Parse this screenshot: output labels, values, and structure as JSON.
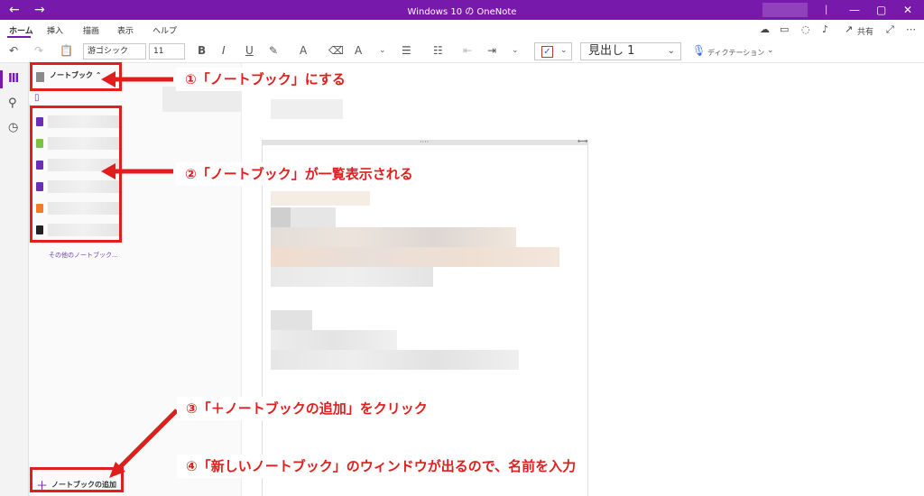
{
  "window": {
    "title": "Windows 10 の OneNote",
    "back_icon": "←",
    "forward_icon": "→",
    "minimize": "—",
    "maximize": "▢",
    "close": "✕"
  },
  "tabs": [
    "ホーム",
    "挿入",
    "描画",
    "表示",
    "ヘルプ"
  ],
  "share_label": "共有",
  "ribbon": {
    "font_name": "游ゴシック",
    "font_size": "11",
    "bold": "B",
    "italic": "I",
    "underline": "U",
    "style": "見出し 1",
    "dictation": "ディクテーション"
  },
  "notebook_pane": {
    "header": "ノートブック",
    "more_notebooks": "その他のノートブック...",
    "add_notebook": "ノートブックの追加",
    "notebook_colors": [
      "#6b2fb3",
      "#7cc242",
      "#6b2fb3",
      "#6b2fb3",
      "#f07b2a",
      "#222222"
    ]
  },
  "annotations": {
    "step1": "①「ノートブック」にする",
    "step2": "②「ノートブック」が一覧表示される",
    "step3": "③「＋ノートブックの追加」をクリック",
    "step4": "④「新しいノートブック」のウィンドウが出るので、名前を入力"
  },
  "colors": {
    "accent": "#7719aa",
    "annotation": "#e11d1d"
  }
}
